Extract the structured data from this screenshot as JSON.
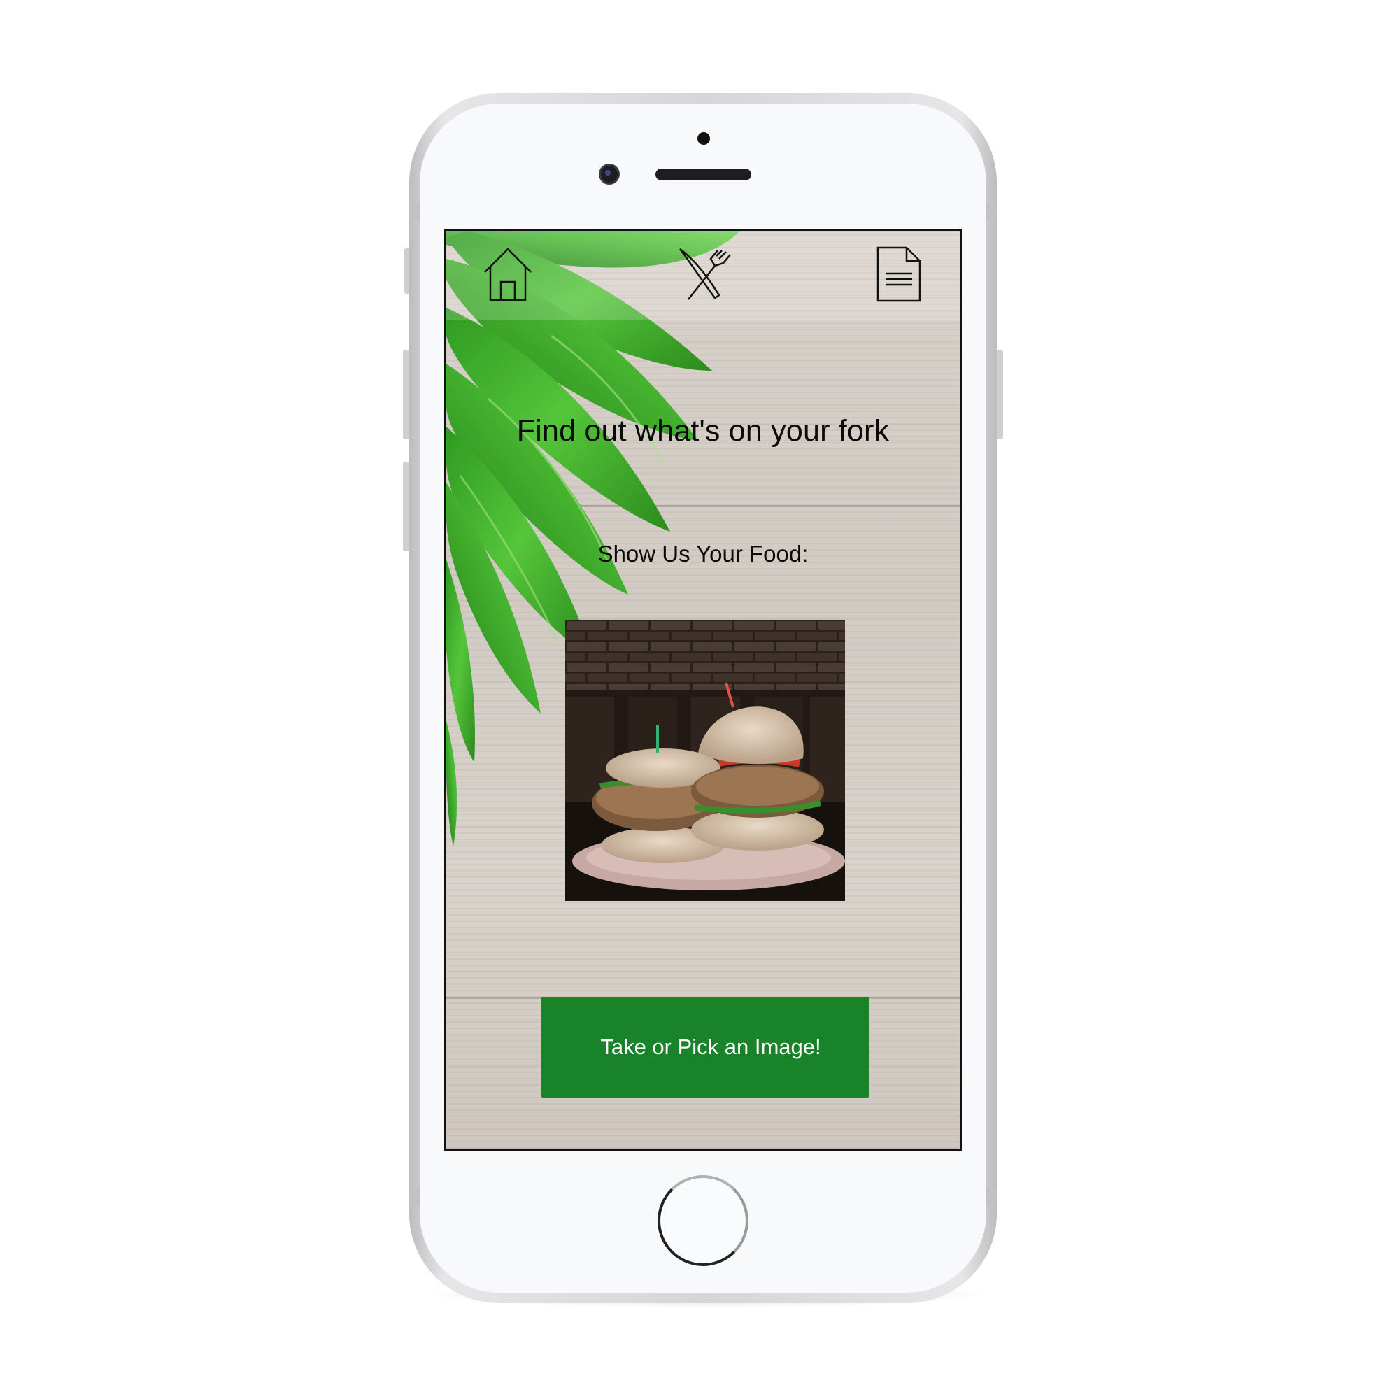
{
  "app": {
    "headline": "Find out what's on your fork",
    "prompt_label": "Show Us Your Food:",
    "primary_button_label": "Take or Pick an Image!"
  },
  "nav": {
    "items": [
      {
        "icon": "home-icon"
      },
      {
        "icon": "fork-knife-icon"
      },
      {
        "icon": "document-icon"
      }
    ]
  },
  "colors": {
    "primary_button": "#188328",
    "leaf_green": "#3fae2c",
    "wood_background": "#d5cec7"
  }
}
